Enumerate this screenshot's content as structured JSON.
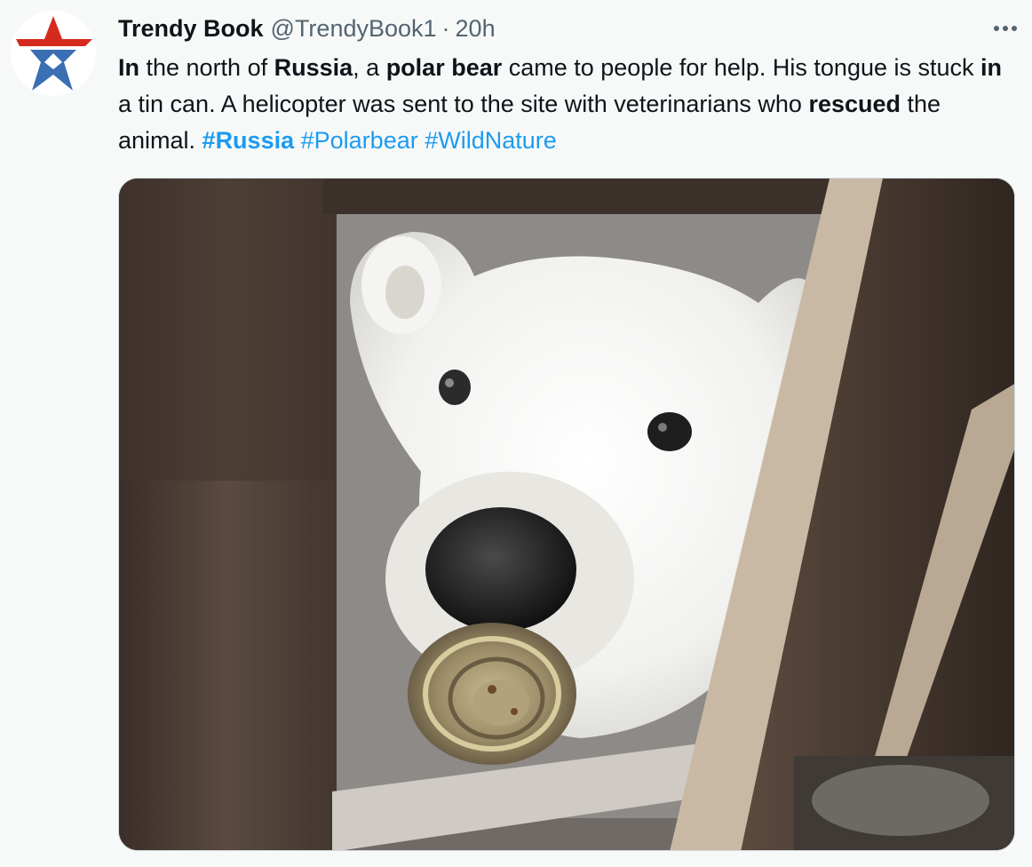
{
  "tweet": {
    "author": {
      "display_name": "Trendy Book",
      "handle": "@TrendyBook1",
      "avatar_icon": "red-blue-star-logo-icon"
    },
    "separator": "·",
    "timestamp": "20h",
    "more_icon": "more-dots-icon",
    "text": {
      "w1": "In",
      "w2": " the north of ",
      "w3": "Russia",
      "w4": ", a ",
      "w5": "polar bear",
      "w6": " came to people for help. His tongue is stuck ",
      "w7": "in",
      "w8": " a tin can. A helicopter was sent to the site with veterinarians who ",
      "w9": "rescued",
      "w10": " the animal. "
    },
    "hashtags": [
      "#Russia",
      "#Polarbear",
      "#WildNature"
    ],
    "colors": {
      "link": "#1d9bf0",
      "secondary_text": "#536471",
      "background": "#f7f9f9",
      "star_red": "#d52b1e",
      "star_blue": "#3a6fb3"
    }
  }
}
